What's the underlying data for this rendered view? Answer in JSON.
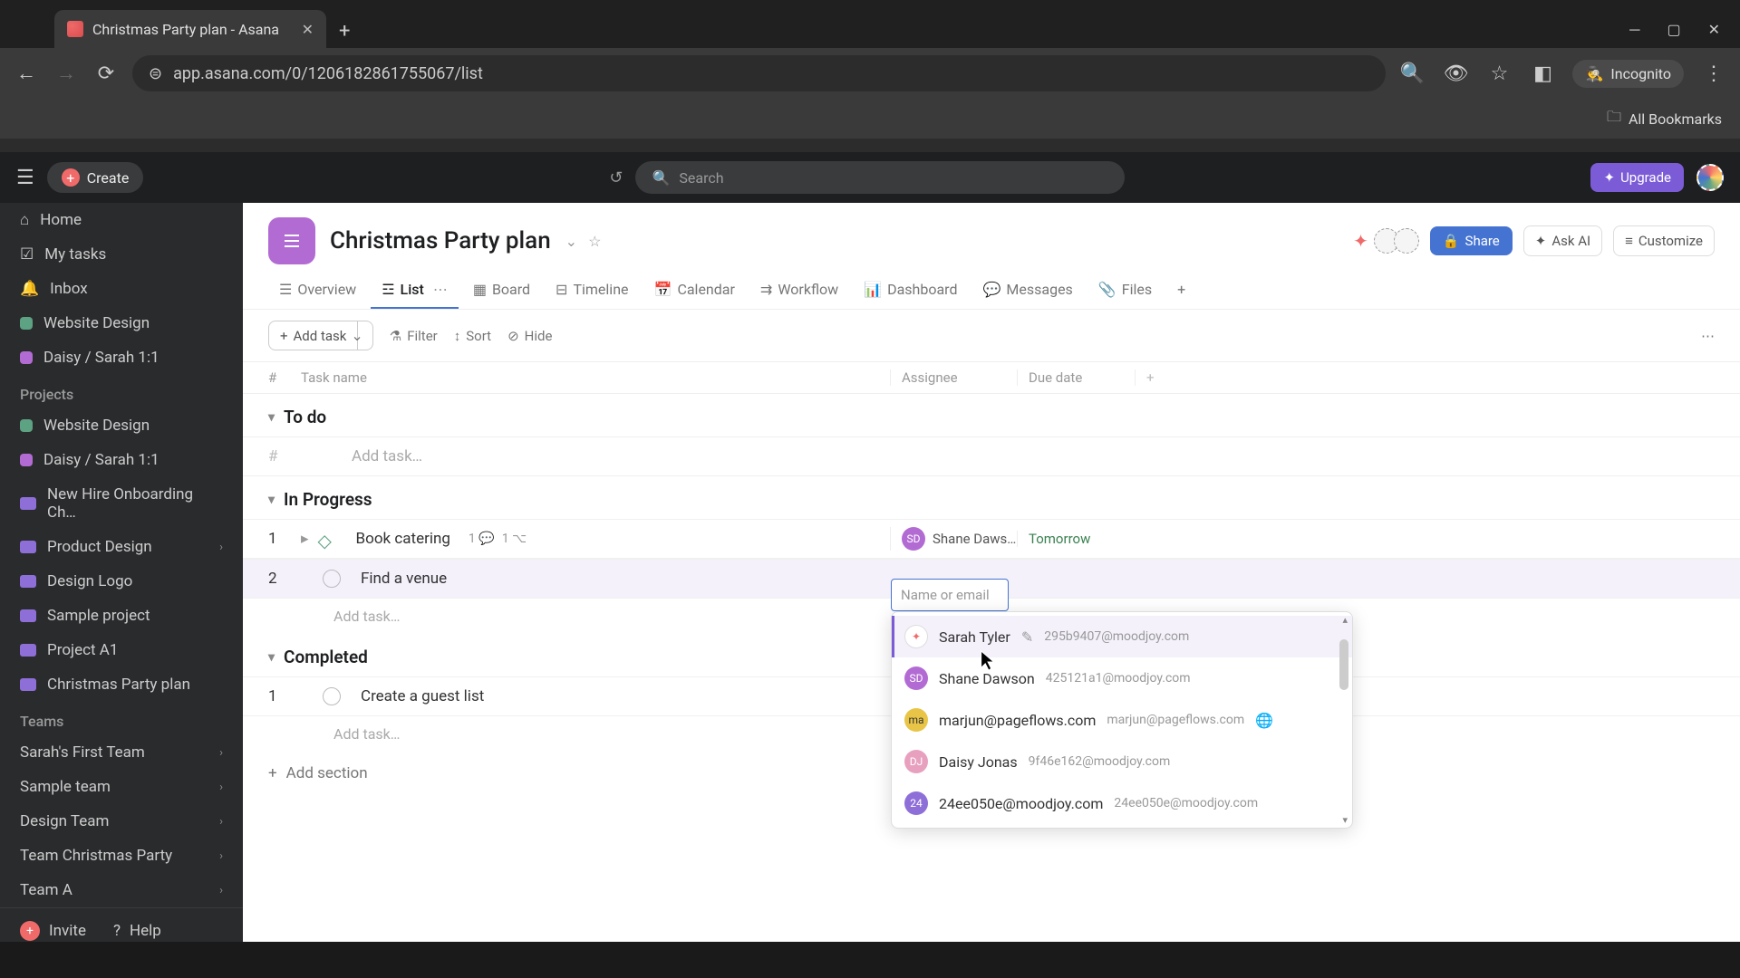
{
  "browser": {
    "tab_title": "Christmas Party plan - Asana",
    "url": "app.asana.com/0/1206182861755067/list",
    "incognito_label": "Incognito",
    "bookmarks_label": "All Bookmarks"
  },
  "topbar": {
    "create_label": "Create",
    "search_placeholder": "Search",
    "upgrade_label": "Upgrade"
  },
  "sidebar": {
    "nav": [
      {
        "icon": "home",
        "label": "Home"
      },
      {
        "icon": "check",
        "label": "My tasks"
      },
      {
        "icon": "inbox",
        "label": "Inbox"
      }
    ],
    "recent": [
      {
        "color": "#5da283",
        "label": "Website Design"
      },
      {
        "color": "#b36bd4",
        "label": "Daisy / Sarah 1:1"
      }
    ],
    "projects_label": "Projects",
    "projects": [
      {
        "color": "#5da283",
        "label": "Website Design",
        "type": "square"
      },
      {
        "color": "#b36bd4",
        "label": "Daisy / Sarah 1:1",
        "type": "square"
      },
      {
        "color": "#8e6fd8",
        "label": "New Hire Onboarding Ch…",
        "type": "folder"
      },
      {
        "color": "#8e6fd8",
        "label": "Product Design",
        "type": "folder",
        "expandable": true
      },
      {
        "color": "#8e6fd8",
        "label": "Design Logo",
        "type": "folder"
      },
      {
        "color": "#8e6fd8",
        "label": "Sample project",
        "type": "folder"
      },
      {
        "color": "#8e6fd8",
        "label": "Project A1",
        "type": "folder"
      },
      {
        "color": "#8e6fd8",
        "label": "Christmas Party plan",
        "type": "folder"
      }
    ],
    "teams_label": "Teams",
    "teams": [
      {
        "label": "Sarah's First Team"
      },
      {
        "label": "Sample team"
      },
      {
        "label": "Design Team"
      },
      {
        "label": "Team Christmas Party"
      },
      {
        "label": "Team A"
      }
    ],
    "invite_label": "Invite",
    "help_label": "Help"
  },
  "project": {
    "title": "Christmas Party plan",
    "tabs": [
      {
        "icon": "overview",
        "label": "Overview"
      },
      {
        "icon": "list",
        "label": "List",
        "active": true
      },
      {
        "icon": "board",
        "label": "Board"
      },
      {
        "icon": "timeline",
        "label": "Timeline"
      },
      {
        "icon": "calendar",
        "label": "Calendar"
      },
      {
        "icon": "workflow",
        "label": "Workflow"
      },
      {
        "icon": "dashboard",
        "label": "Dashboard"
      },
      {
        "icon": "messages",
        "label": "Messages"
      },
      {
        "icon": "files",
        "label": "Files"
      }
    ],
    "share_label": "Share",
    "askai_label": "Ask AI",
    "customize_label": "Customize"
  },
  "toolbar": {
    "addtask_label": "Add task",
    "filter_label": "Filter",
    "sort_label": "Sort",
    "hide_label": "Hide"
  },
  "columns": {
    "num": "#",
    "name": "Task name",
    "assignee": "Assignee",
    "due": "Due date"
  },
  "sections": {
    "todo": {
      "title": "To do",
      "num_placeholder": "#",
      "addtask": "Add task…"
    },
    "inprogress": {
      "title": "In Progress",
      "tasks": [
        {
          "num": "1",
          "name": "Book catering",
          "milestone": true,
          "comments": "1",
          "subtasks": "1",
          "assignee_initials": "SD",
          "assignee_color": "#b36bd4",
          "assignee_name": "Shane Daws…",
          "due": "Tomorrow"
        },
        {
          "num": "2",
          "name": "Find a venue",
          "milestone": false
        }
      ],
      "addtask": "Add task…"
    },
    "completed": {
      "title": "Completed",
      "tasks": [
        {
          "num": "1",
          "name": "Create a guest list"
        }
      ],
      "addtask": "Add task…"
    }
  },
  "addsection_label": "Add section",
  "assignee_input_placeholder": "Name or email",
  "assignee_dropdown": [
    {
      "initials": "✦",
      "color": "#fff",
      "border": true,
      "name": "Sarah Tyler",
      "badge": true,
      "email": "295b9407@moodjoy.com",
      "highlighted": true
    },
    {
      "initials": "SD",
      "color": "#b36bd4",
      "name": "Shane Dawson",
      "email": "425121a1@moodjoy.com"
    },
    {
      "initials": "ma",
      "color": "#e8c547",
      "name": "marjun@pageflows.com",
      "email": "marjun@pageflows.com",
      "globe": true
    },
    {
      "initials": "DJ",
      "color": "#e8a0bf",
      "name": "Daisy Jonas",
      "email": "9f46e162@moodjoy.com"
    },
    {
      "initials": "24",
      "color": "#8e6fd8",
      "name": "24ee050e@moodjoy.com",
      "email": "24ee050e@moodjoy.com"
    }
  ]
}
